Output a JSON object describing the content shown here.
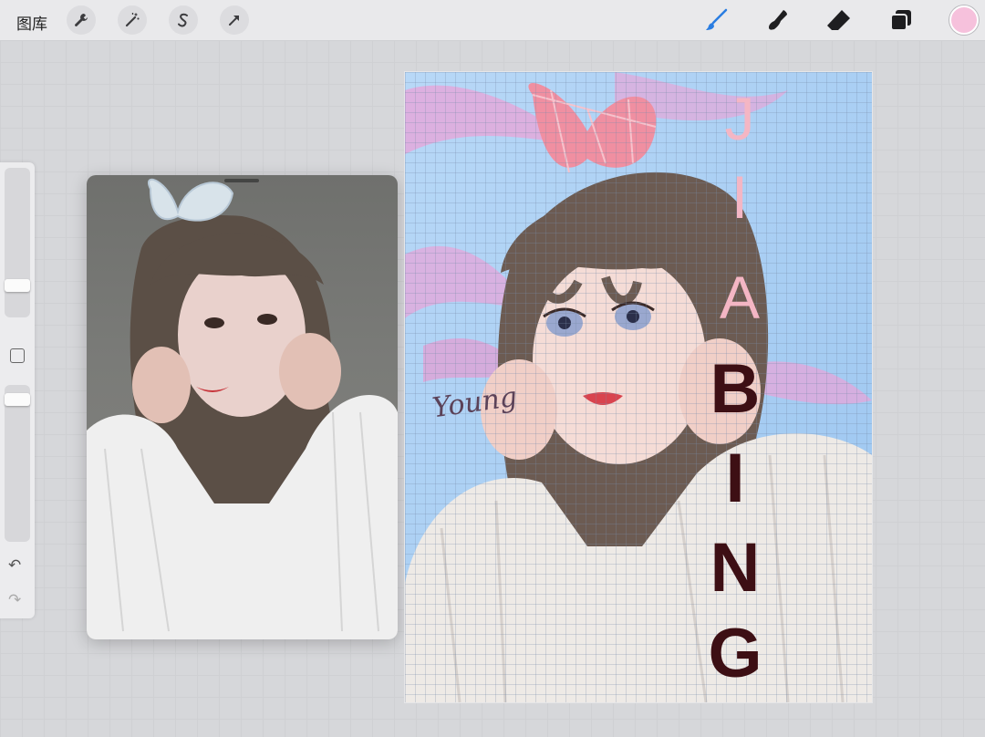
{
  "topbar": {
    "gallery_label": "图库",
    "tools_left": [
      "wrench-icon",
      "magic-wand-icon",
      "selection-icon",
      "transform-arrow-icon"
    ],
    "tools_right": [
      "brush-icon",
      "smudge-icon",
      "eraser-icon",
      "layers-icon"
    ],
    "current_color": "#f6c1dc",
    "active_tool_color": "#2a7de1"
  },
  "sidebar": {
    "brush_size_level": 0.78,
    "opacity_level": 0.95,
    "controls": [
      "brush-size-slider",
      "modify-button",
      "opacity-slider",
      "undo-icon",
      "redo-icon"
    ]
  },
  "reference": {
    "description_icon": "reference-photo"
  },
  "artwork": {
    "title_top": [
      "J",
      "I",
      "A"
    ],
    "title_bottom": [
      "B",
      "I",
      "N",
      "G"
    ],
    "signature": "Young"
  }
}
